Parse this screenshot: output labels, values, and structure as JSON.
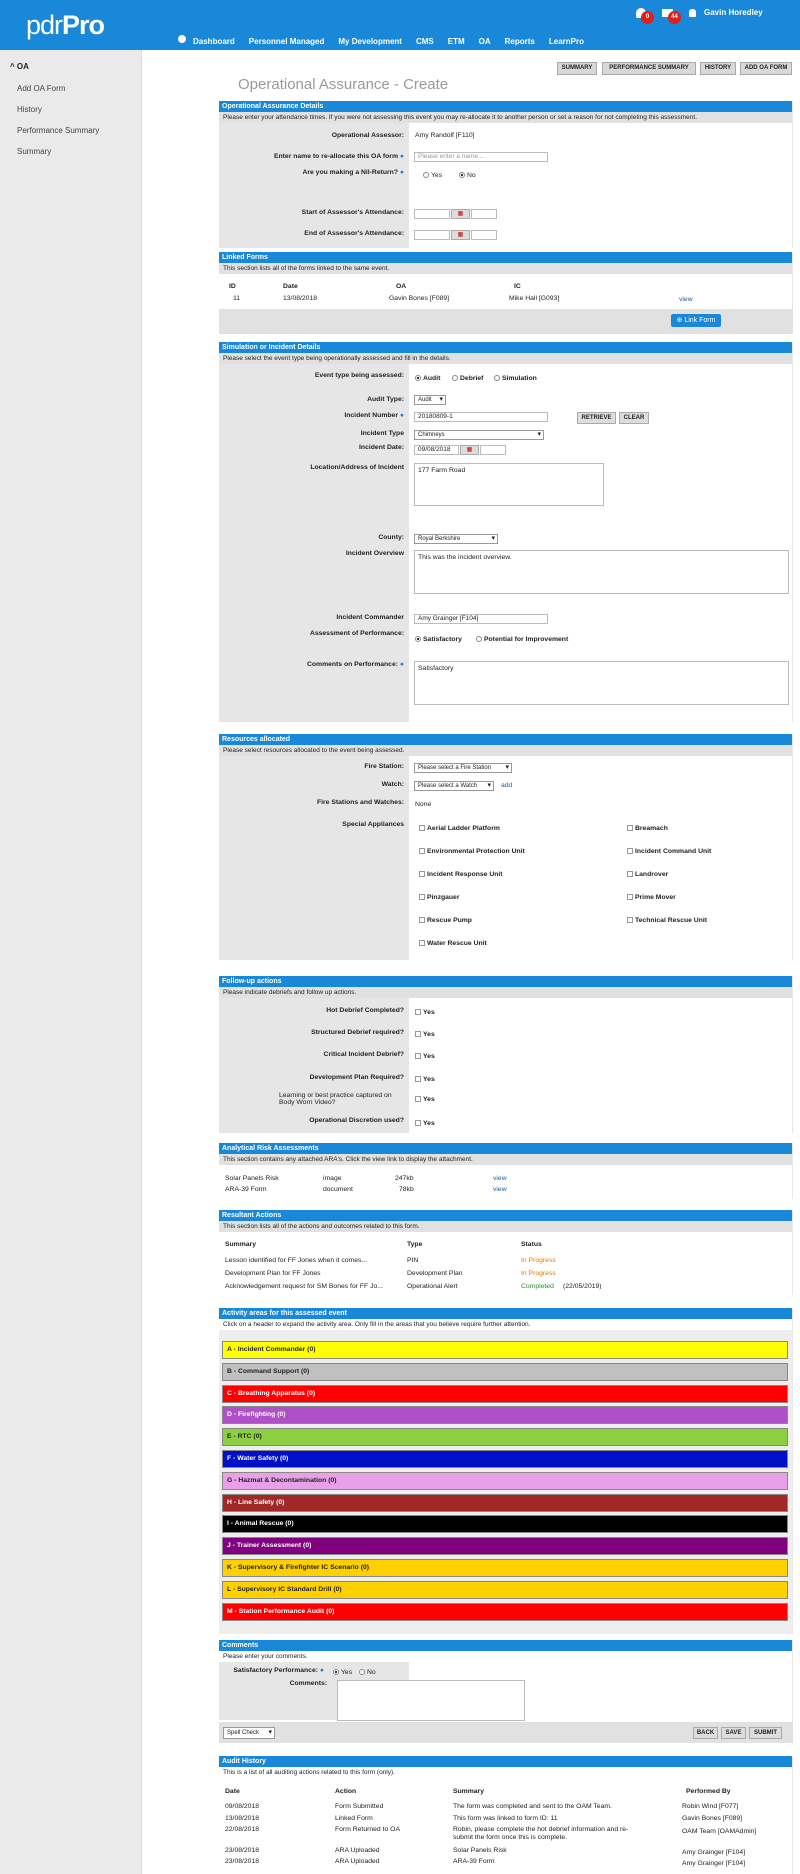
{
  "app": {
    "logo_a": "pdr",
    "logo_b": "Pro",
    "notif_count": "0",
    "mail_count": "44",
    "user": "Gavin Horedley"
  },
  "nav": [
    "Dashboard",
    "Personnel Managed",
    "My Development",
    "CMS",
    "ETM",
    "OA",
    "Reports",
    "LearnPro"
  ],
  "sidebar": {
    "header": "OA",
    "items": [
      "Add OA Form",
      "History",
      "Performance Summary",
      "Summary"
    ]
  },
  "top_buttons": [
    "SUMMARY",
    "PERFORMANCE SUMMARY",
    "HISTORY",
    "ADD OA FORM"
  ],
  "page_title": "Operational Assurance - Create",
  "oad": {
    "title": "Operational Assurance Details",
    "desc": "Please enter your attendance times. If you were not assessing this event you may re-allocate it to another person or set a reason for not completing this assessment.",
    "assessor_label": "Operational Assessor:",
    "assessor": "Amy Randolf [F110]",
    "realloc_label": "Enter name to re-allocate this OA form",
    "realloc_ph": "Please enter a name...",
    "nil_label": "Are you making a Nil-Return?",
    "yes": "Yes",
    "no": "No",
    "start_label": "Start of Assessor's Attendance:",
    "end_label": "End of Assessor's Attendance:"
  },
  "linked": {
    "title": "Linked Forms",
    "desc": "This section lists all of the forms linked to the same event.",
    "cols": [
      "ID",
      "Date",
      "OA",
      "IC"
    ],
    "rows": [
      [
        "11",
        "13/08/2018",
        "Gavin Bones [F089]",
        "Mike Hall [G093]",
        "view"
      ]
    ],
    "btn": "Link Form"
  },
  "sim": {
    "title": "Simulation or Incident Details",
    "desc": "Please select the event type being operationally assessed and fill in the details.",
    "event_label": "Event type being assessed:",
    "event_opts": [
      "Audit",
      "Debrief",
      "Simulation"
    ],
    "audit_label": "Audit Type:",
    "audit_val": "Audit",
    "incnum_label": "Incident Number",
    "incnum": "20180809-1",
    "retrieve": "RETRIEVE",
    "clear": "CLEAR",
    "inctype_label": "Incident Type",
    "inctype": "Chimneys",
    "incdate_label": "Incident Date:",
    "incdate": "09/08/2018",
    "loc_label": "Location/Address of Incident",
    "loc": "177 Farm Road",
    "county_label": "County:",
    "county": "Royal Berkshire",
    "overview_label": "Incident Overview",
    "overview": "This was the incident overview.",
    "ic_label": "Incident Commander",
    "ic": "Amy Grainger [F104]",
    "perf_label": "Assessment of Performance:",
    "perf_opts": [
      "Satisfactory",
      "Potential for Improvement"
    ],
    "comm_label": "Comments on Performance:",
    "comm": "Satisfactory"
  },
  "res": {
    "title": "Resources allocated",
    "desc": "Please select resources allocated to the event being assessed.",
    "station_label": "Fire Station:",
    "station": "Please select a Fire Station",
    "watch_label": "Watch:",
    "watch": "Please select a Watch",
    "add": "add",
    "fsw_label": "Fire Stations and Watches:",
    "fsw": "None",
    "spec_label": "Special Appliances",
    "left": [
      "Aerial Ladder Platform",
      "Environmental Protection Unit",
      "Incident Response Unit",
      "Pinzgauer",
      "Rescue Pump",
      "Water Rescue Unit"
    ],
    "right": [
      "Breamach",
      "Incident Command Unit",
      "Landrover",
      "Prime Mover",
      "Technical Rescue Unit"
    ]
  },
  "fu": {
    "title": "Follow-up actions",
    "desc": "Please indicate debriefs and follow up actions.",
    "items": [
      "Hot Debrief Completed?",
      "Structured Debrief required?",
      "Critical Incident Debrief?",
      "Development Plan Required?",
      "Learning or best practice captured on Body Worn Video?",
      "Operational Discretion used?"
    ],
    "yes": "Yes"
  },
  "ara": {
    "title": "Analytical Risk Assessments",
    "desc": "This section contains any attached ARA's. Click the view link to display the attachment.",
    "rows": [
      [
        "Solar Panels Risk",
        "image",
        "247kb",
        "view"
      ],
      [
        "ARA-39 Form",
        "document",
        "78kb",
        "view"
      ]
    ]
  },
  "ra": {
    "title": "Resultant Actions",
    "desc": "This section lists all of the actions and outcomes related to this form.",
    "cols": [
      "Summary",
      "Type",
      "Status"
    ],
    "rows": [
      [
        "Lesson identified for FF Jones when it comes...",
        "PIN",
        "In Progress",
        ""
      ],
      [
        "Development Plan for FF Jones",
        "Development Plan",
        "In Progress",
        ""
      ],
      [
        "Acknowledgement request for SM Bones for FF Jo...",
        "Operational Alert",
        "Completed",
        "(22/05/2019)"
      ]
    ]
  },
  "areas": {
    "title": "Activity areas for this assessed event",
    "desc": "Click on a header to expand the activity area. Only fill in the areas that you believe require further attention.",
    "items": [
      {
        "label": "A - Incident Commander (0)",
        "bg": "#ffff00",
        "fg": "#222"
      },
      {
        "label": "B - Command Support (0)",
        "bg": "#c0c0c0",
        "fg": "#222"
      },
      {
        "label": "C - Breathing Apparatus (0)",
        "bg": "#ff0000",
        "fg": "#fff"
      },
      {
        "label": "D - Firefighting (0)",
        "bg": "#b050c8",
        "fg": "#fff"
      },
      {
        "label": "E - RTC (0)",
        "bg": "#8cd040",
        "fg": "#222"
      },
      {
        "label": "F - Water Safety (0)",
        "bg": "#0010c8",
        "fg": "#fff"
      },
      {
        "label": "G - Hazmat & Decontamination (0)",
        "bg": "#e8a0e8",
        "fg": "#222"
      },
      {
        "label": "H - Line Safety (0)",
        "bg": "#a02828",
        "fg": "#fff"
      },
      {
        "label": "I - Animal Rescue (0)",
        "bg": "#000000",
        "fg": "#fff"
      },
      {
        "label": "J - Trainer Assessment (0)",
        "bg": "#800080",
        "fg": "#fff"
      },
      {
        "label": "K - Supervisory & Firefighter IC Scenario (0)",
        "bg": "#ffd000",
        "fg": "#222"
      },
      {
        "label": "L - Supervisory IC Standard Drill (0)",
        "bg": "#ffd000",
        "fg": "#222"
      },
      {
        "label": "M - Station Performance Audit (0)",
        "bg": "#ff0000",
        "fg": "#fff"
      }
    ]
  },
  "comments": {
    "title": "Comments",
    "desc": "Please enter your comments.",
    "sat_label": "Satisfactory Performance:",
    "yes": "Yes",
    "no": "No",
    "comm_label": "Comments:",
    "spell": "Spell Check",
    "back": "BACK",
    "save": "SAVE",
    "submit": "SUBMIT"
  },
  "audit": {
    "title": "Audit History",
    "desc": "This is a list of all auditing actions related to this form (only).",
    "cols": [
      "Date",
      "Action",
      "Summary",
      "Performed By"
    ],
    "rows": [
      [
        "09/08/2018",
        "Form Submitted",
        "The form was completed and sent to the OAM Team.",
        "Robin Wind [F077]"
      ],
      [
        "13/08/2018",
        "Linked Form",
        "This form was linked to form ID: 11",
        "Gavin Bones [F089]"
      ],
      [
        "22/08/2018",
        "Form Returned to OA",
        "Robin, please complete the hot debrief information and re-submit the form once this is complete.",
        "OAM Team [OAMAdmin]"
      ],
      [
        "23/08/2018",
        "ARA Uploaded",
        "Solar Panels Risk",
        "Amy Grainger [F104]"
      ],
      [
        "23/08/2018",
        "ARA Uploaded",
        "ARA-39 Form",
        "Amy Grainger [F104]"
      ]
    ]
  }
}
